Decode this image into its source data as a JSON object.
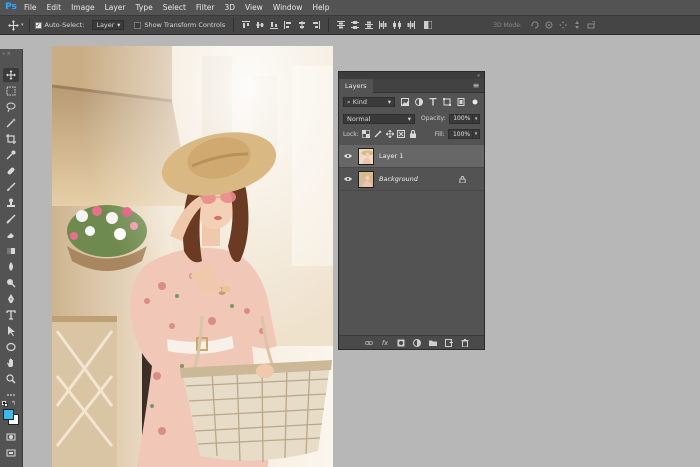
{
  "app": {
    "logo": "Ps"
  },
  "menu": [
    "File",
    "Edit",
    "Image",
    "Layer",
    "Type",
    "Select",
    "Filter",
    "3D",
    "View",
    "Window",
    "Help"
  ],
  "options_bar": {
    "auto_select_label": "Auto-Select:",
    "auto_select_checked": true,
    "auto_select_target": "Layer",
    "show_transform_label": "Show Transform Controls",
    "show_transform_checked": false,
    "mode_label": "3D Mode:"
  },
  "layers_panel": {
    "tab_label": "Layers",
    "filter_kind": "Kind",
    "blend_mode": "Normal",
    "opacity_label": "Opacity:",
    "opacity_value": "100%",
    "lock_label": "Lock:",
    "fill_label": "Fill:",
    "fill_value": "100%",
    "layers": [
      {
        "name": "Layer 1",
        "selected": true,
        "visible": true,
        "italic": false,
        "locked": false
      },
      {
        "name": "Background",
        "selected": false,
        "visible": true,
        "italic": true,
        "locked": true
      }
    ]
  },
  "colors": {
    "workspace": "#b7b7b7",
    "panel": "#535353",
    "accent": "#31a8ff",
    "foreground_swatch": "#3cb9e8",
    "background_swatch": "#ffffff"
  }
}
